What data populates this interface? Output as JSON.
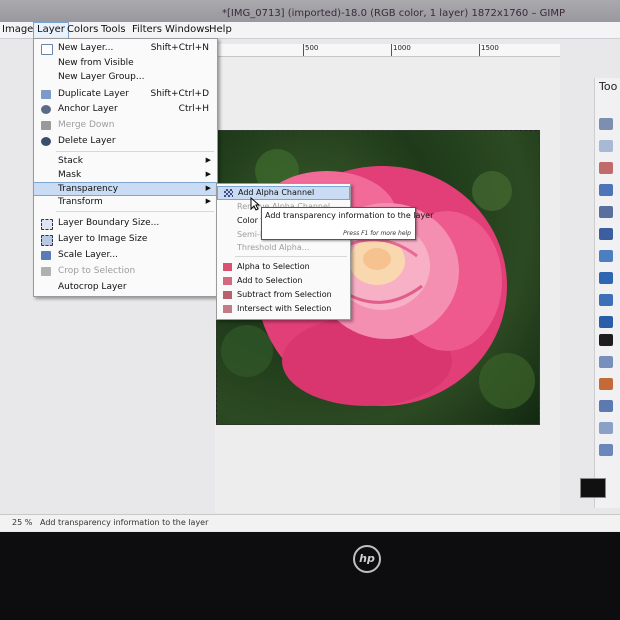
{
  "window": {
    "title": "*[IMG_0713] (imported)-18.0 (RGB color, 1 layer) 1872x1760 – GIMP"
  },
  "menubar": {
    "items": [
      "Image",
      "Layer",
      "Colors",
      "Tools",
      "Filters",
      "Windows",
      "Help"
    ],
    "active": "Layer"
  },
  "ruler": {
    "labels": [
      "500",
      "1000",
      "1500"
    ]
  },
  "layer_menu": {
    "items": [
      {
        "label": "New Layer...",
        "shortcut": "Shift+Ctrl+N",
        "icon": "new-layer-icon"
      },
      {
        "label": "New from Visible",
        "shortcut": "",
        "icon": ""
      },
      {
        "label": "New Layer Group...",
        "shortcut": "",
        "icon": ""
      },
      {
        "label": "Duplicate Layer",
        "shortcut": "Shift+Ctrl+D",
        "icon": "duplicate-layer-icon"
      },
      {
        "label": "Anchor Layer",
        "shortcut": "Ctrl+H",
        "icon": "anchor-icon"
      },
      {
        "label": "Merge Down",
        "shortcut": "",
        "icon": "merge-down-icon"
      },
      {
        "label": "Delete Layer",
        "shortcut": "",
        "icon": "delete-layer-icon"
      },
      {
        "label": "Stack",
        "shortcut": "",
        "icon": ""
      },
      {
        "label": "Mask",
        "shortcut": "",
        "icon": ""
      },
      {
        "label": "Transparency",
        "shortcut": "",
        "icon": ""
      },
      {
        "label": "Transform",
        "shortcut": "",
        "icon": ""
      },
      {
        "label": "Layer Boundary Size...",
        "shortcut": "",
        "icon": "layer-boundary-icon"
      },
      {
        "label": "Layer to Image Size",
        "shortcut": "",
        "icon": "layer-to-image-icon"
      },
      {
        "label": "Scale Layer...",
        "shortcut": "",
        "icon": "scale-layer-icon"
      },
      {
        "label": "Crop to Selection",
        "shortcut": "",
        "icon": "crop-icon"
      },
      {
        "label": "Autocrop Layer",
        "shortcut": "",
        "icon": ""
      }
    ]
  },
  "transparency_menu": {
    "items": [
      {
        "label": "Add Alpha Channel",
        "icon": "alpha-channel-icon"
      },
      {
        "label": "Remove Alpha Channel",
        "icon": ""
      },
      {
        "label": "Color to Alpha...",
        "icon": ""
      },
      {
        "label": "Semi-Flatten...",
        "icon": ""
      },
      {
        "label": "Threshold Alpha...",
        "icon": ""
      },
      {
        "label": "Alpha to Selection",
        "icon": "alpha-to-selection-icon"
      },
      {
        "label": "Add to Selection",
        "icon": "add-to-selection-icon"
      },
      {
        "label": "Subtract from Selection",
        "icon": "subtract-selection-icon"
      },
      {
        "label": "Intersect with Selection",
        "icon": "intersect-selection-icon"
      }
    ]
  },
  "tooltip": {
    "text": "Add transparency information to the layer",
    "help": "Press F1 for more help"
  },
  "toolbox": {
    "title": "Too"
  },
  "statusbar": {
    "zoom": "25 %",
    "message": "Add transparency information to the layer"
  },
  "bezel": {
    "logo": "hp"
  },
  "colors": {
    "menu_highlight": "#c9dcf3",
    "rose_pink": "#e8447a",
    "foliage": "#2c4a22"
  }
}
